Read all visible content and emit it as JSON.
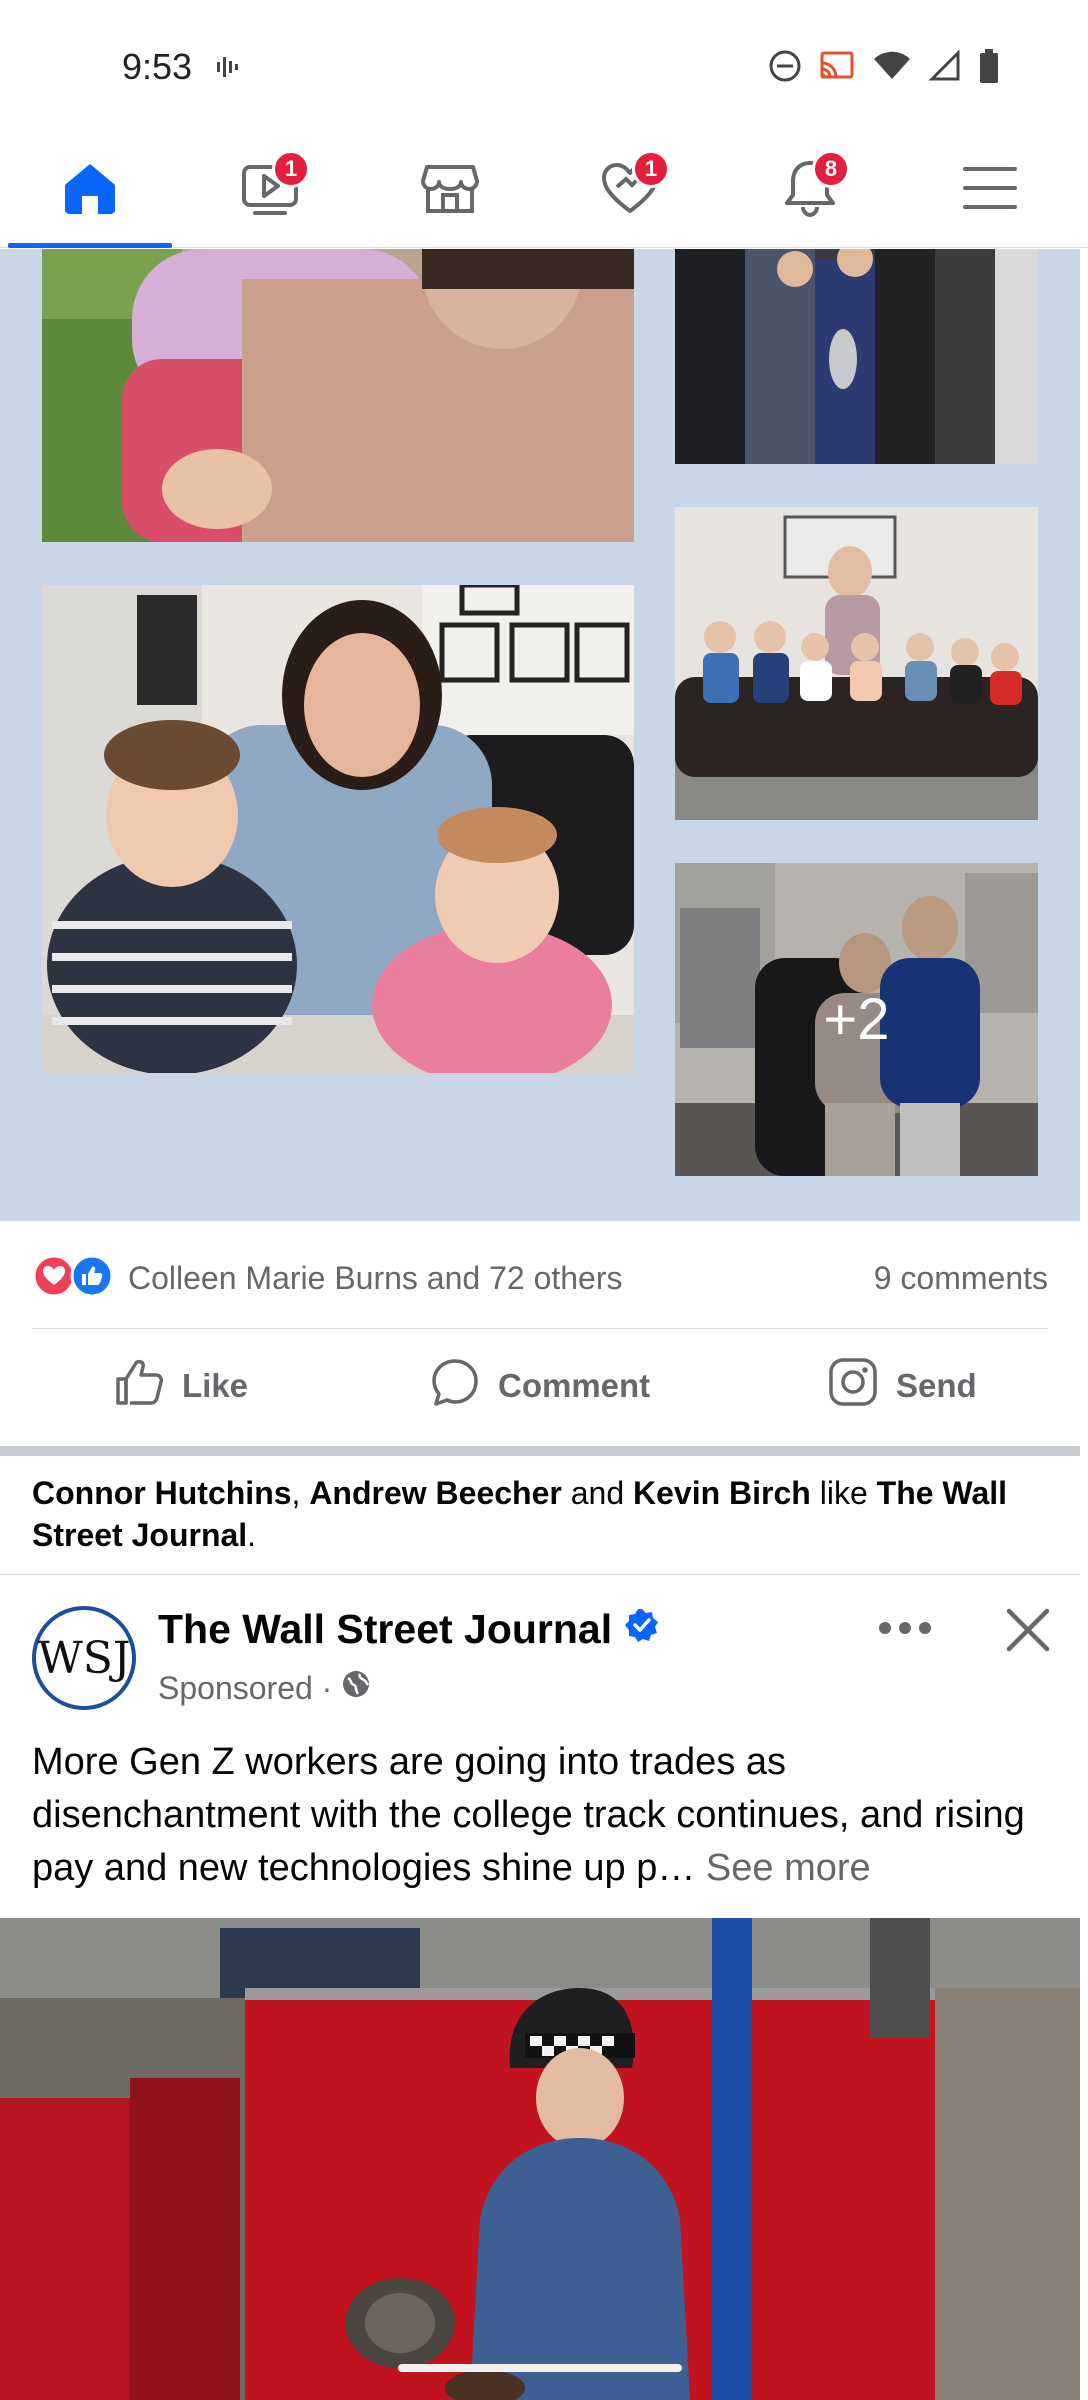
{
  "status_bar": {
    "time": "9:53",
    "icons": [
      "voice-activity-icon",
      "do-not-disturb-icon",
      "cast-icon",
      "wifi-icon",
      "cell-signal-icon",
      "battery-icon"
    ]
  },
  "nav": {
    "items": [
      {
        "name": "home",
        "icon": "home-icon",
        "active": true,
        "badge": ""
      },
      {
        "name": "video",
        "icon": "video-icon",
        "active": false,
        "badge": "1"
      },
      {
        "name": "marketplace",
        "icon": "marketplace-icon",
        "active": false,
        "badge": ""
      },
      {
        "name": "dating",
        "icon": "heart-icon",
        "active": false,
        "badge": "1"
      },
      {
        "name": "notifications",
        "icon": "bell-icon",
        "active": false,
        "badge": "8"
      },
      {
        "name": "menu",
        "icon": "menu-icon",
        "active": false,
        "badge": ""
      }
    ]
  },
  "post": {
    "photos_more_label": "+2",
    "reactions_text": "Colleen Marie Burns and 72 others",
    "reaction_icons": [
      "love-reaction-icon",
      "like-reaction-icon"
    ],
    "comments_text": "9 comments",
    "actions": {
      "like": "Like",
      "comment": "Comment",
      "send": "Send"
    }
  },
  "social_context": {
    "person1": "Connor Hutchins",
    "sep1": ", ",
    "person2": "Andrew Beecher",
    "sep2": " and ",
    "person3": "Kevin Birch",
    "verb": " like ",
    "page": "The Wall Street Journal",
    "end": "."
  },
  "ad": {
    "avatar_text": "WSJ",
    "name": "The Wall Street Journal",
    "sponsored": "Sponsored ·",
    "body": "More Gen Z workers are going into trades as disenchantment with the college track continues, and rising pay and new technologies shine up p…",
    "see_more": "See more"
  },
  "colors": {
    "brand_blue": "#0866ff",
    "badge_red": "#e41e3f",
    "grid_bg": "#c8d6e5",
    "muted_text": "#65676b"
  }
}
